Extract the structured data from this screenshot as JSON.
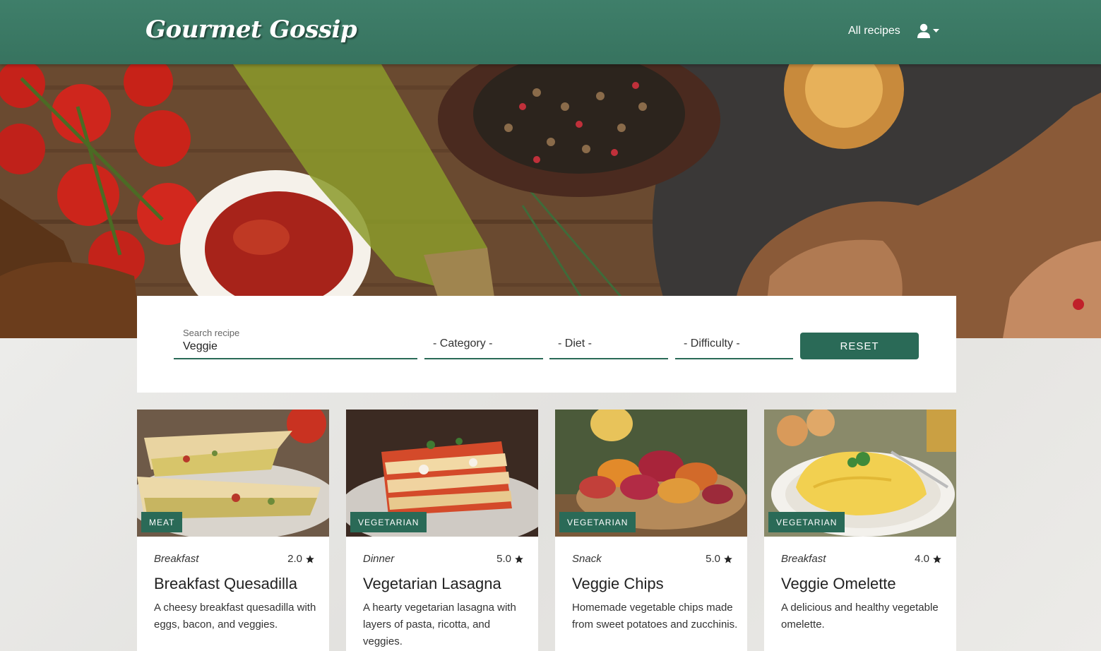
{
  "header": {
    "logo": "Gourmet Gossip",
    "nav_all_recipes": "All recipes"
  },
  "search": {
    "label": "Search recipe",
    "value": "Veggie",
    "category": "- Category -",
    "diet": "- Diet -",
    "difficulty": "- Difficulty -",
    "reset_label": "RESET"
  },
  "recipes": [
    {
      "badge": "MEAT",
      "category": "Breakfast",
      "rating": "2.0",
      "title": "Breakfast Quesadilla",
      "description": "A cheesy breakfast quesadilla with eggs, bacon, and veggies."
    },
    {
      "badge": "VEGETARIAN",
      "category": "Dinner",
      "rating": "5.0",
      "title": "Vegetarian Lasagna",
      "description": "A hearty vegetarian lasagna with layers of pasta, ricotta, and veggies."
    },
    {
      "badge": "VEGETARIAN",
      "category": "Snack",
      "rating": "5.0",
      "title": "Veggie Chips",
      "description": "Homemade vegetable chips made from sweet potatoes and zucchinis."
    },
    {
      "badge": "VEGETARIAN",
      "category": "Breakfast",
      "rating": "4.0",
      "title": "Veggie Omelette",
      "description": "A delicious and healthy vegetable omelette."
    }
  ],
  "colors": {
    "brand_green": "#2a6a57",
    "header_green": "#3f7f6a"
  }
}
